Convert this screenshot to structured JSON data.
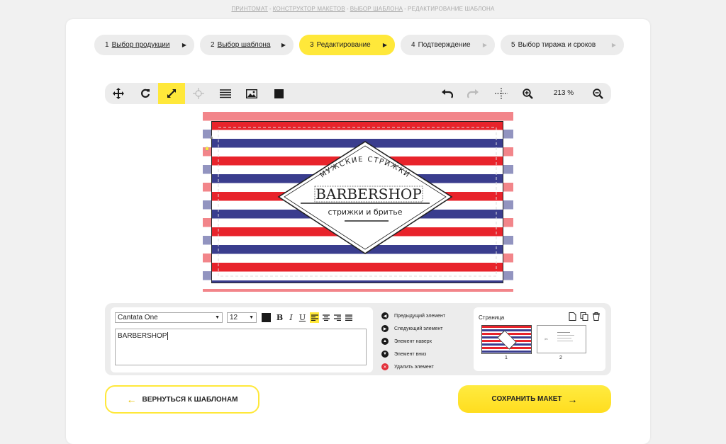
{
  "breadcrumb": [
    {
      "label": "Принтомат",
      "link": true
    },
    {
      "label": "Конструктор макетов",
      "link": true
    },
    {
      "label": "Выбор шаблона",
      "link": true
    },
    {
      "label": "Редактирование шаблона",
      "link": false
    }
  ],
  "steps": [
    {
      "num": "1",
      "label": "Выбор продукции",
      "state": "done"
    },
    {
      "num": "2",
      "label": "Выбор шаблона",
      "state": "done"
    },
    {
      "num": "3",
      "label": "Редактирование",
      "state": "active"
    },
    {
      "num": "4",
      "label": "Подтверждение",
      "state": "pending"
    },
    {
      "num": "5",
      "label": "Выбор тиража и сроков",
      "state": "pending"
    }
  ],
  "toolbar": {
    "zoom": "213 %",
    "tools": [
      "move-icon",
      "rotate-icon",
      "resize-icon",
      "crosshair-icon",
      "lines-icon",
      "image-icon",
      "square-icon"
    ],
    "right_tools": [
      "undo-icon",
      "redo-icon",
      "center-icon",
      "zoom-in-icon",
      "zoom-out-icon"
    ]
  },
  "card": {
    "arc_text": "МУЖСКИЕ СТРИЖКИ",
    "title": "BARBERSHOP",
    "subtitle": "стрижки и бритье"
  },
  "editor": {
    "font": "Cantata One",
    "size": "12",
    "text": "BARBERSHOP",
    "bold": "B",
    "italic": "I",
    "underline": "U"
  },
  "element_actions": [
    {
      "label": "Предыдущий элемент",
      "icon": "arrow-left-icon"
    },
    {
      "label": "Следующий элемент",
      "icon": "arrow-right-icon"
    },
    {
      "label": "Элемент наверх",
      "icon": "arrow-up-icon"
    },
    {
      "label": "Элемент вниз",
      "icon": "arrow-down-icon"
    },
    {
      "label": "Удалить элемент",
      "icon": "delete-icon"
    }
  ],
  "pages": {
    "title": "Страница",
    "items": [
      "1",
      "2"
    ]
  },
  "buttons": {
    "back": "ВЕРНУТЬСЯ К ШАБЛОНАМ",
    "save": "СОХРАНИТЬ МАКЕТ"
  },
  "colors": {
    "accent": "#ffe83a",
    "stripe_red": "#e8232b",
    "stripe_blue": "#3a3d8e"
  }
}
